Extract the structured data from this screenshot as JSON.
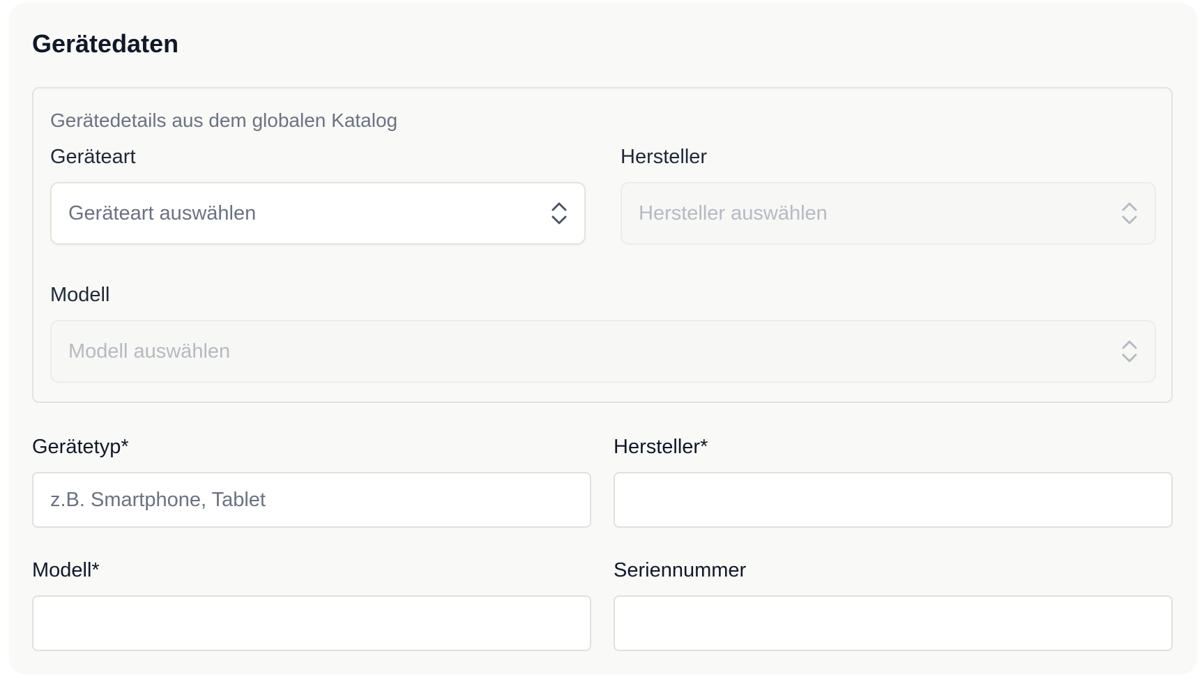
{
  "section": {
    "title": "Gerätedaten"
  },
  "catalog": {
    "description": "Gerätedetails aus dem globalen Katalog",
    "device_kind": {
      "label": "Geräteart",
      "placeholder": "Geräteart auswählen"
    },
    "manufacturer": {
      "label": "Hersteller",
      "placeholder": "Hersteller auswählen"
    },
    "model": {
      "label": "Modell",
      "placeholder": "Modell auswählen"
    }
  },
  "form": {
    "device_type": {
      "label": "Gerätetyp*",
      "placeholder": "z.B. Smartphone, Tablet",
      "value": ""
    },
    "manufacturer": {
      "label": "Hersteller*",
      "placeholder": "",
      "value": ""
    },
    "model": {
      "label": "Modell*",
      "placeholder": "",
      "value": ""
    },
    "serial_number": {
      "label": "Seriennummer",
      "placeholder": "",
      "value": ""
    }
  },
  "icons": {
    "select_chevron": "chevron-up-down-icon"
  },
  "colors": {
    "card_background": "#f9f9f7",
    "border": "#e3e3e0",
    "text_primary": "#111827",
    "text_muted": "#6b7280",
    "text_disabled": "#b6bac1"
  }
}
